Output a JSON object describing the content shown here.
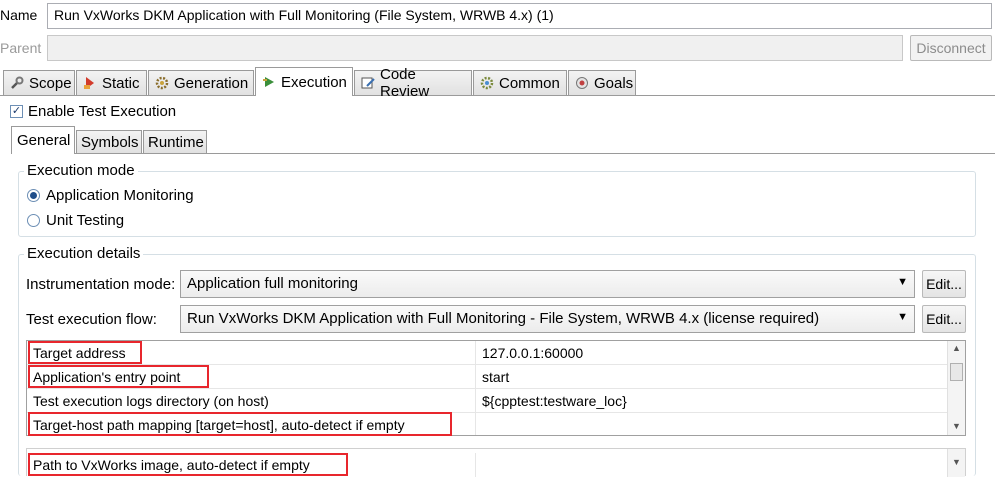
{
  "name": {
    "label": "Name",
    "value": "Run VxWorks DKM Application with Full Monitoring (File System, WRWB 4.x) (1)"
  },
  "parent": {
    "label": "Parent",
    "value": "",
    "disconnect_label": "Disconnect"
  },
  "tabs": [
    {
      "label": "Scope",
      "icon": "wrench-icon"
    },
    {
      "label": "Static",
      "icon": "static-analysis-icon"
    },
    {
      "label": "Generation",
      "icon": "gear-icon"
    },
    {
      "label": "Execution",
      "icon": "execution-icon"
    },
    {
      "label": "Code Review",
      "icon": "code-review-icon"
    },
    {
      "label": "Common",
      "icon": "common-gear-icon"
    },
    {
      "label": "Goals",
      "icon": "goals-icon"
    }
  ],
  "active_tab": "Execution",
  "enable_test_execution": {
    "label": "Enable Test Execution",
    "checked": true
  },
  "subtabs": [
    {
      "label": "General"
    },
    {
      "label": "Symbols"
    },
    {
      "label": "Runtime"
    }
  ],
  "execution_mode": {
    "title": "Execution mode",
    "options": [
      {
        "label": "Application Monitoring",
        "selected": true
      },
      {
        "label": "Unit Testing",
        "selected": false
      }
    ]
  },
  "execution_details": {
    "title": "Execution details",
    "instrumentation_mode": {
      "label": "Instrumentation mode:",
      "value": "Application full monitoring",
      "edit_label": "Edit..."
    },
    "test_execution_flow": {
      "label": "Test execution flow:",
      "value": "Run VxWorks DKM Application with Full Monitoring - File System, WRWB 4.x (license required)",
      "edit_label": "Edit..."
    }
  },
  "properties": [
    {
      "key": "Target address",
      "value": "127.0.0.1:60000",
      "highlighted": true
    },
    {
      "key": "Application's entry point",
      "value": "start",
      "highlighted": true
    },
    {
      "key": "Test execution logs directory (on host)",
      "value": "${cpptest:testware_loc}",
      "highlighted": false
    },
    {
      "key": "Target-host path mapping [target=host], auto-detect if empty",
      "value": "",
      "highlighted": true
    }
  ],
  "overflow_property": {
    "key": "Path to VxWorks image, auto-detect if empty",
    "value": "",
    "highlighted": true
  },
  "colors": {
    "highlight": "#e8262d",
    "radio_dot": "#1f4e8a",
    "tab_border": "#9a9a9a"
  }
}
